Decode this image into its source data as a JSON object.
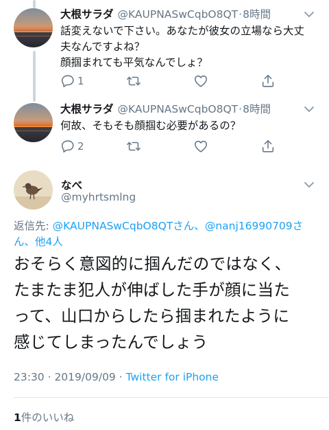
{
  "colors": {
    "link": "#1da1f2",
    "secondary": "#657786",
    "line": "#ccd6dd",
    "divider": "#e1e8ed"
  },
  "replies": [
    {
      "name": "大根サラダ",
      "handle": "@KAUPNASwCqbO8QT",
      "dot": "·",
      "time": "8時間",
      "lines": [
        "話変えないで下さい。あなたが彼女の立場なら大丈",
        "夫なんですよね？",
        "顔掴まれても平気なんでしょ？"
      ],
      "reply_count": "1",
      "icons": [
        "comment-icon",
        "retweet-icon",
        "like-icon",
        "share-icon"
      ]
    },
    {
      "name": "大根サラダ",
      "handle": "@KAUPNASwCqbO8QT",
      "dot": "·",
      "time": "8時間",
      "lines": [
        "何故、そもそも顔掴む必要があるの？"
      ],
      "reply_count": "2",
      "icons": [
        "comment-icon",
        "retweet-icon",
        "like-icon",
        "share-icon"
      ]
    }
  ],
  "main": {
    "name": "なべ",
    "handle": "@myhrtsmlng",
    "reply_prefix": "返信先: ",
    "reply_link1": "@KAUPNASwCqbO8QTさん",
    "reply_sep": "、",
    "reply_link2": "@nanj16990709さ",
    "reply_link3": "ん、他4人",
    "text_lines": [
      "おそらく意図的に掴んだのではなく、",
      "たまたま犯人が伸ばした手が顔に当た",
      "って、山口からしたら掴まれたように",
      "感じてしまったんでしょう"
    ],
    "timestamp": "23:30 · 2019/09/09 · ",
    "source": "Twitter for iPhone",
    "likes_count": "1",
    "likes_label": "件のいいね"
  }
}
